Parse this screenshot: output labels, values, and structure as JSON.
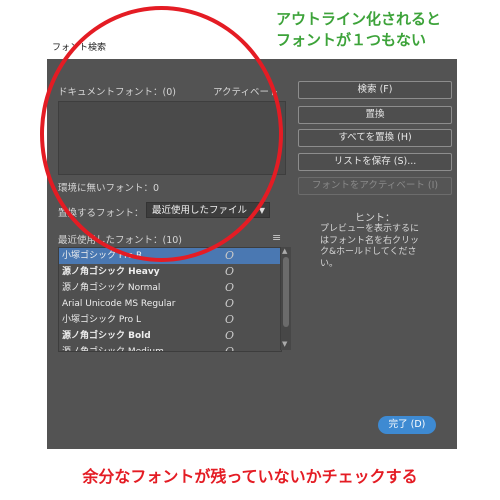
{
  "annotation": {
    "green_note_line1": "アウトライン化されると",
    "green_note_line2": "フォントが１つもない",
    "red_note": "余分なフォントが残っていないかチェックする"
  },
  "window": {
    "title": "フォント検索"
  },
  "document_fonts": {
    "label": "ドキュメントフォント：(0)",
    "column_active": "アクティベート"
  },
  "missing_fonts": {
    "label": "環境に無いフォント：0"
  },
  "replace": {
    "label": "置換するフォント：",
    "selected": "最近使用したファイル"
  },
  "recent_fonts": {
    "label": "最近使用したフォント：(10)",
    "items": [
      {
        "name": "小塚ゴシック Pro R",
        "glyph": "O",
        "selected": true,
        "bold": false
      },
      {
        "name": "源ノ角ゴシック Heavy",
        "glyph": "O",
        "selected": false,
        "bold": true
      },
      {
        "name": "源ノ角ゴシック Normal",
        "glyph": "O",
        "selected": false,
        "bold": false
      },
      {
        "name": "Arial Unicode MS Regular",
        "glyph": "O",
        "selected": false,
        "bold": false
      },
      {
        "name": "小塚ゴシック Pro L",
        "glyph": "O",
        "selected": false,
        "bold": false
      },
      {
        "name": "源ノ角ゴシック Bold",
        "glyph": "O",
        "selected": false,
        "bold": true
      },
      {
        "name": "源ノ角ゴシック Medium",
        "glyph": "O",
        "selected": false,
        "bold": false
      }
    ]
  },
  "buttons": {
    "find": "検索 (F)",
    "replace": "置換",
    "replace_all": "すべてを置換 (H)",
    "save_list": "リストを保存 (S)...",
    "activate_fonts": "フォントをアクティベート (I)",
    "done": "完了 (D)"
  },
  "hint": {
    "title": "ヒント：",
    "body": "プレビューを表示するにはフォント名を右クリック&ホールドしてください。"
  },
  "colors": {
    "dialog_bg": "#535353",
    "accent_blue": "#3e8ad2",
    "annotation_red": "#e41c24",
    "annotation_green": "#3da33a"
  }
}
